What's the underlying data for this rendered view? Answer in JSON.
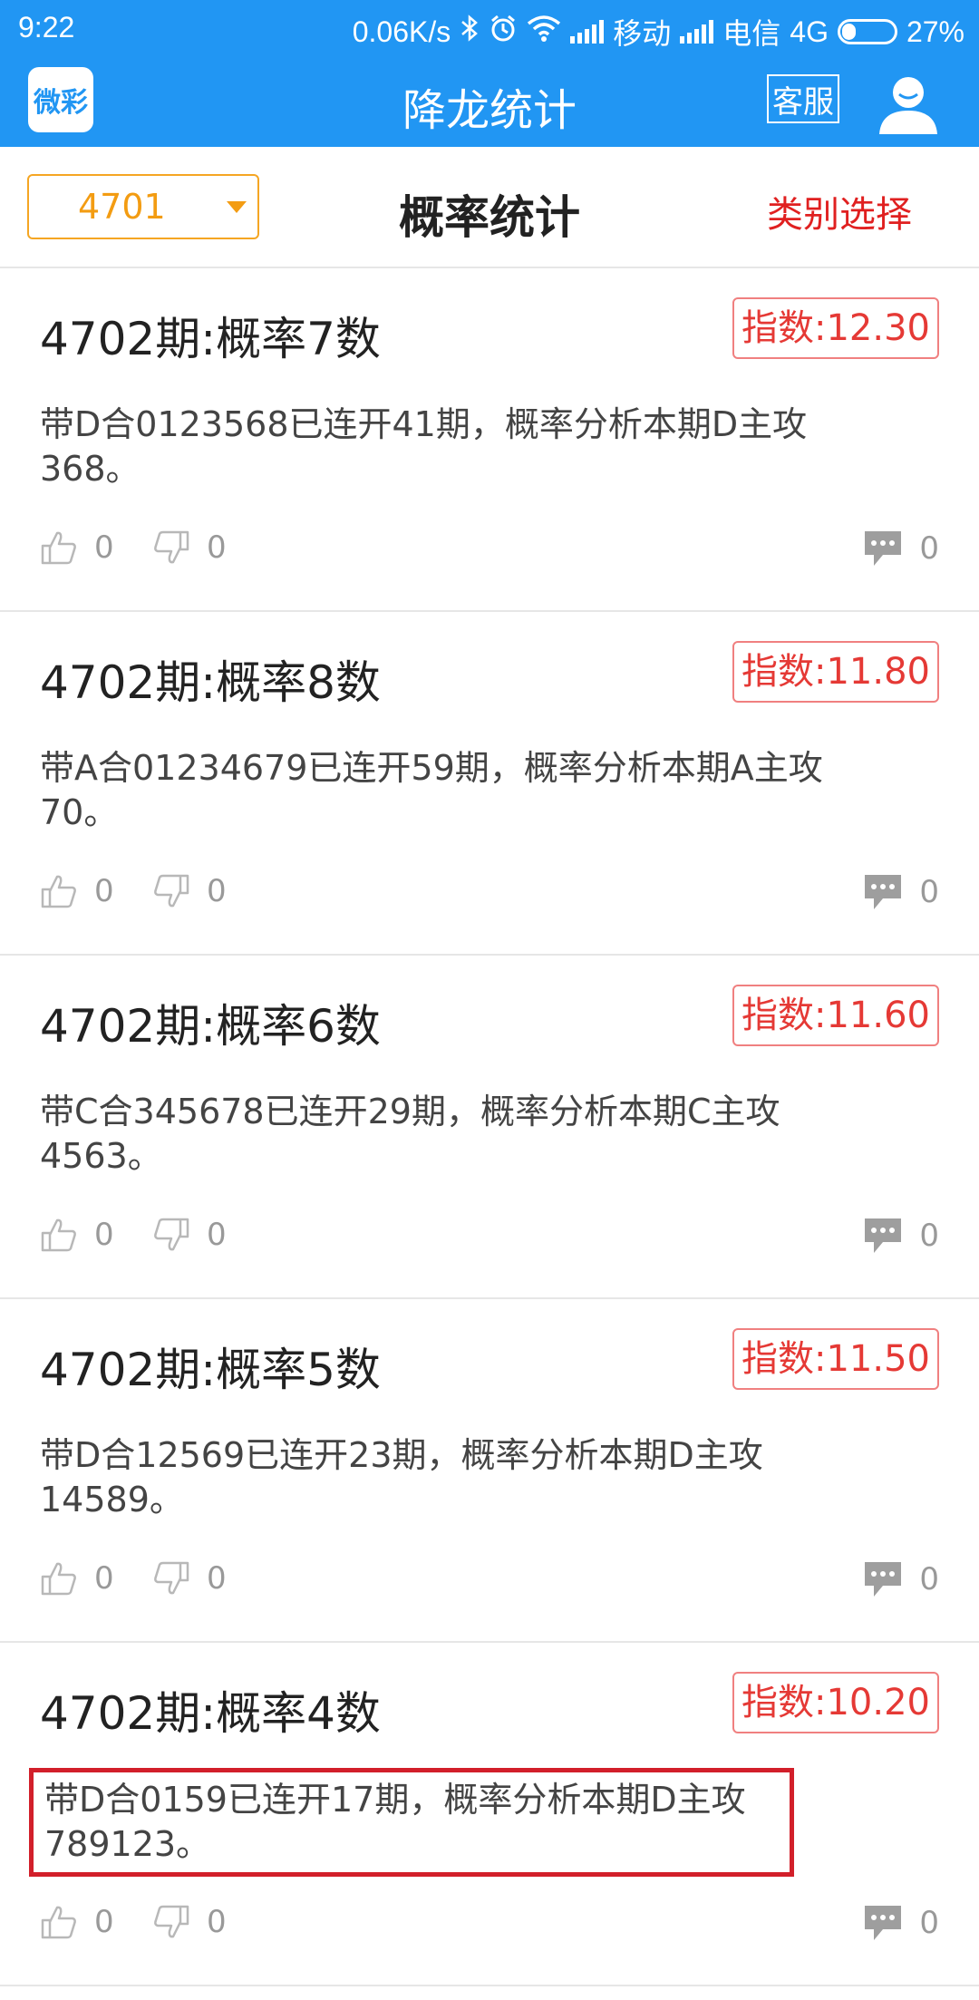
{
  "status_bar": {
    "time": "9:22",
    "net_speed": "0.06K/s",
    "carrier1": "移动",
    "carrier2": "电信",
    "network_type": "4G",
    "battery": "27%",
    "battery_level": 0.27,
    "icons": [
      "bluetooth-icon",
      "alarm-icon",
      "wifi-icon",
      "signal-icon",
      "battery-icon"
    ]
  },
  "app_bar": {
    "logo_text": "微彩",
    "title": "降龙统计",
    "service_label": "客服",
    "user_icon": "user-icon"
  },
  "filter_bar": {
    "period_value": "4701",
    "title": "概率统计",
    "category_label": "类别选择"
  },
  "colors": {
    "primary": "#2196f3",
    "accent_orange": "#f39c12",
    "accent_red": "#e53935",
    "highlight_box": "#d21f2a"
  },
  "cards": [
    {
      "title": "4702期:概率7数",
      "index": "指数:12.30",
      "body": "带D合0123568已连开41期，概率分析本期D主攻368。",
      "likes": "0",
      "dislikes": "0",
      "comments": "0"
    },
    {
      "title": "4702期:概率8数",
      "index": "指数:11.80",
      "body": "带A合01234679已连开59期，概率分析本期A主攻70。",
      "likes": "0",
      "dislikes": "0",
      "comments": "0"
    },
    {
      "title": "4702期:概率6数",
      "index": "指数:11.60",
      "body": "带C合345678已连开29期，概率分析本期C主攻4563。",
      "likes": "0",
      "dislikes": "0",
      "comments": "0"
    },
    {
      "title": "4702期:概率5数",
      "index": "指数:11.50",
      "body": "带D合12569已连开23期，概率分析本期D主攻14589。",
      "likes": "0",
      "dislikes": "0",
      "comments": "0"
    },
    {
      "title": "4702期:概率4数",
      "index": "指数:10.20",
      "body": "带D合0159已连开17期，概率分析本期D主攻789123。",
      "likes": "0",
      "dislikes": "0",
      "comments": "0"
    }
  ]
}
